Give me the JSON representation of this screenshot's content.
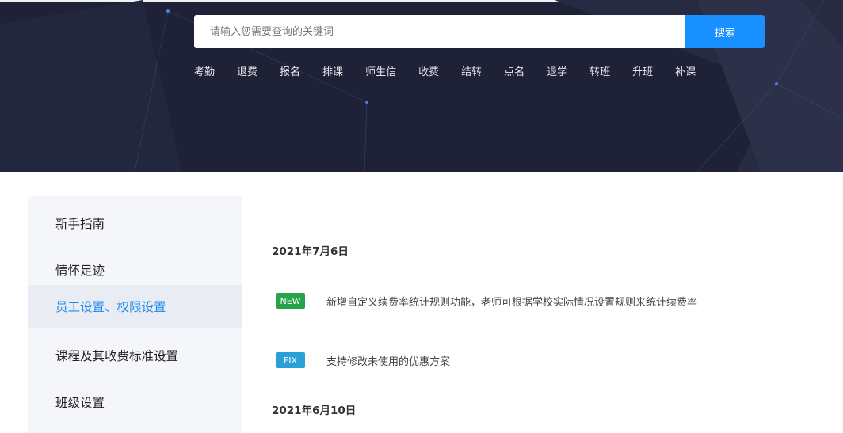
{
  "search": {
    "placeholder": "请输入您需要查询的关键词",
    "button_label": "搜索"
  },
  "quick_links": [
    "考勤",
    "退费",
    "报名",
    "排课",
    "师生信",
    "收费",
    "结转",
    "点名",
    "退学",
    "转班",
    "升班",
    "补课"
  ],
  "sidebar": {
    "items": [
      {
        "label": "新手指南",
        "active": false
      },
      {
        "label": "情怀足迹",
        "active": false
      },
      {
        "label": "员工设置、权限设置",
        "active": true
      },
      {
        "label": "课程及其收费标准设置",
        "active": false
      },
      {
        "label": "班级设置",
        "active": false
      }
    ]
  },
  "changelog": {
    "dates": [
      "2021年7月6日",
      "2021年6月10日"
    ],
    "entries": [
      {
        "tag": "NEW",
        "text": "新增自定义续费率统计规则功能，老师可根据学校实际情况设置规则来统计续费率"
      },
      {
        "tag": "FIX",
        "text": "支持修改未使用的优惠方案"
      }
    ]
  },
  "colors": {
    "hero_bg": "#1f2236",
    "accent": "#1890ff",
    "active_link": "#1a8cf0",
    "tag_new": "#27a34a",
    "tag_fix": "#2aa0d9"
  }
}
